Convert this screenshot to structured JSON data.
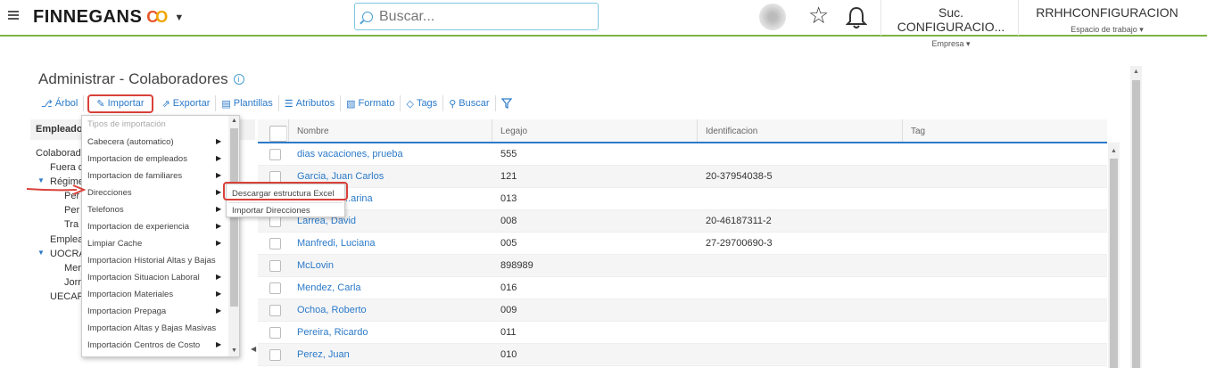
{
  "header": {
    "brand": "FINNEGANS",
    "search_placeholder": "Buscar...",
    "company": {
      "name": "Suc. CONFIGURACIO...",
      "label": "Empresa ▾"
    },
    "workspace": {
      "name": "RRHHCONFIGURACION",
      "label": "Espacio de trabajo ▾"
    }
  },
  "page": {
    "title": "Administrar - Colaboradores"
  },
  "toolbar": {
    "items": [
      {
        "label": "Árbol",
        "icon": "tree-icon"
      },
      {
        "label": "Importar",
        "icon": "import-icon"
      },
      {
        "label": "Exportar",
        "icon": "export-icon"
      },
      {
        "label": "Plantillas",
        "icon": "template-icon"
      },
      {
        "label": "Atributos",
        "icon": "list-icon"
      },
      {
        "label": "Formato",
        "icon": "format-icon"
      },
      {
        "label": "Tags",
        "icon": "tag-icon"
      },
      {
        "label": "Buscar",
        "icon": "search-icon"
      }
    ]
  },
  "tree": {
    "header": "Empleado",
    "items": [
      "Colaborad",
      "Fuera d",
      "Régime",
      "Per",
      "Per",
      "Tra",
      "Emplea",
      "UOCRA",
      "Mer",
      "Jorr",
      "UECAF"
    ]
  },
  "grid": {
    "columns": [
      "Nombre",
      "Legajo",
      "Identificacion",
      "Tag"
    ],
    "rows": [
      {
        "nombre": "dias vacaciones, prueba",
        "legajo": "555",
        "id": "",
        "tag": ""
      },
      {
        "nombre": "Garcia, Juan Carlos",
        "legajo": "121",
        "id": "20-37954038-5",
        "tag": ""
      },
      {
        "nombre": "...arina",
        "legajo": "013",
        "id": "",
        "tag": ""
      },
      {
        "nombre": "Larrea, David",
        "legajo": "008",
        "id": "20-46187311-2",
        "tag": ""
      },
      {
        "nombre": "Manfredi, Luciana",
        "legajo": "005",
        "id": "27-29700690-3",
        "tag": ""
      },
      {
        "nombre": "McLovin",
        "legajo": "898989",
        "id": "",
        "tag": ""
      },
      {
        "nombre": "Mendez, Carla",
        "legajo": "016",
        "id": "",
        "tag": ""
      },
      {
        "nombre": "Ochoa, Roberto",
        "legajo": "009",
        "id": "",
        "tag": ""
      },
      {
        "nombre": "Pereira, Ricardo",
        "legajo": "011",
        "id": "",
        "tag": ""
      },
      {
        "nombre": "Perez, Juan",
        "legajo": "010",
        "id": "",
        "tag": ""
      }
    ]
  },
  "import_menu": {
    "header": "Tipos de importación",
    "items": [
      "Cabecera (automatico)",
      "Importacion de empleados",
      "Importacion de familiares",
      "Direcciones",
      "Telefonos",
      "Importacion de experiencia",
      "Limpiar Cache",
      "Importacion Historial Altas y Bajas",
      "Importacion Situacion Laboral",
      "Importacion Materiales",
      "Importacion Prepaga",
      "Importacion Altas y Bajas Masivas",
      "Importación Centros de Costo"
    ]
  },
  "submenu": {
    "items": [
      "Descargar estructura Excel",
      "Importar Direcciones"
    ]
  },
  "colors": {
    "accent": "#2b7ac9",
    "highlight": "#d9413a",
    "topbar_border": "#7cb342"
  }
}
